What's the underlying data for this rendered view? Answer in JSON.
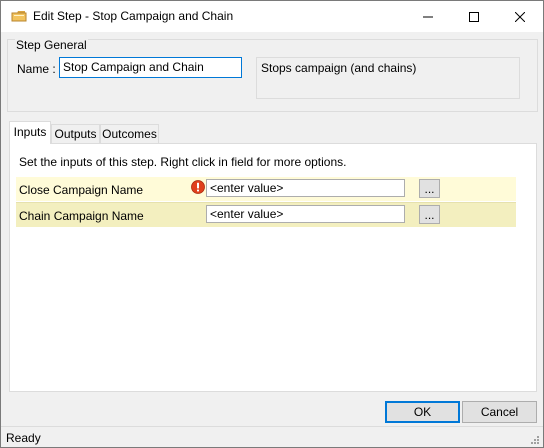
{
  "window": {
    "title": "Edit Step - Stop Campaign and Chain",
    "app_icon": "folder-icon",
    "controls": [
      "minimize-icon",
      "maximize-icon",
      "close-icon"
    ]
  },
  "step_general": {
    "group_title": "Step General",
    "name_label": "Name :",
    "name_value": "Stop Campaign and Chain",
    "description": "Stops campaign (and chains)"
  },
  "tabs": [
    {
      "label": "Inputs",
      "active": true
    },
    {
      "label": "Outputs",
      "active": false
    },
    {
      "label": "Outcomes",
      "active": false
    }
  ],
  "inputs_panel": {
    "instructions": "Set the inputs of this step.  Right click in field for more options.",
    "rows": [
      {
        "label": "Close Campaign Name",
        "value": "<enter value>",
        "has_error": true,
        "browse_label": "..."
      },
      {
        "label": "Chain Campaign Name",
        "value": "<enter value>",
        "has_error": false,
        "browse_label": "..."
      }
    ]
  },
  "buttons": {
    "ok_label": "OK",
    "cancel_label": "Cancel"
  },
  "status_bar": {
    "text": "Ready"
  },
  "colors": {
    "accent": "#0078d7",
    "row_odd": "#fffbd8",
    "row_even": "#f3efbf",
    "error": "#e0401c"
  }
}
